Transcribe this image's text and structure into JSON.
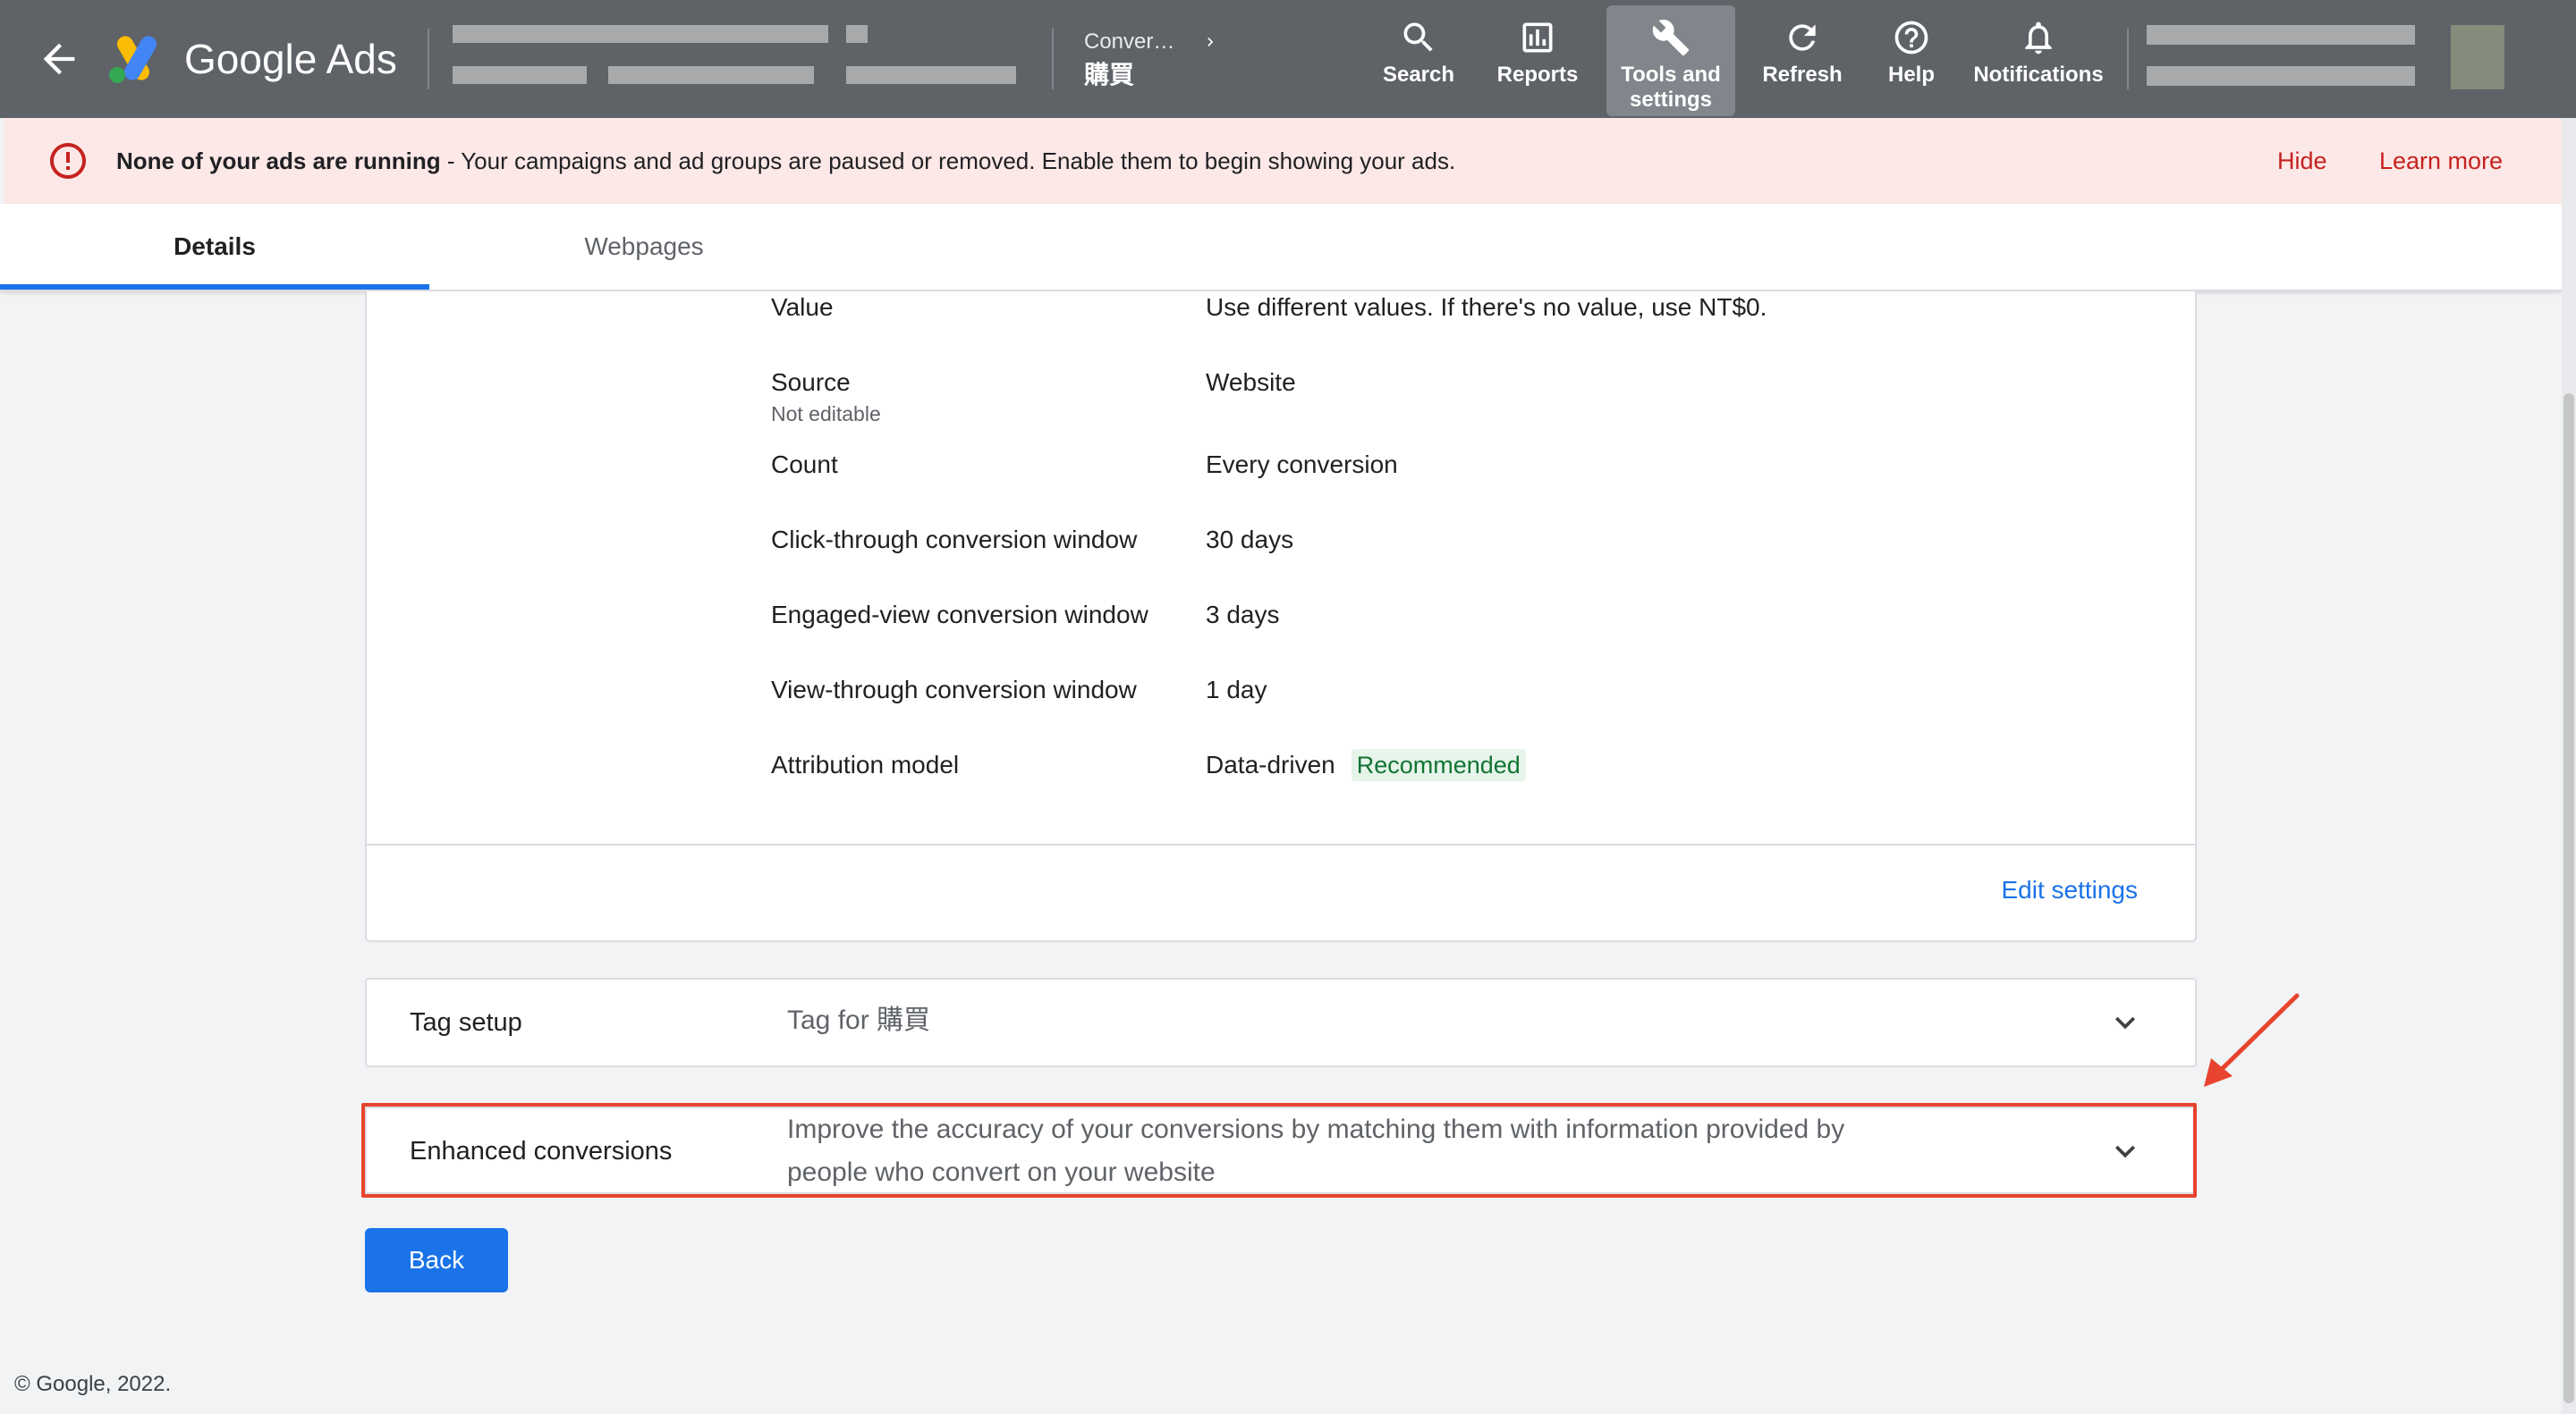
{
  "header": {
    "product_name": "Google Ads",
    "breadcrumb": {
      "parent": "Conver…",
      "current": "購買"
    },
    "nav": [
      {
        "label": "Search",
        "icon": "search-icon"
      },
      {
        "label": "Reports",
        "icon": "reports-icon"
      },
      {
        "label": "Tools and settings",
        "icon": "wrench-icon",
        "active": true
      },
      {
        "label": "Refresh",
        "icon": "refresh-icon"
      },
      {
        "label": "Help",
        "icon": "help-icon"
      },
      {
        "label": "Notifications",
        "icon": "bell-icon"
      }
    ]
  },
  "alert": {
    "bold": "None of your ads are running",
    "text": " - Your campaigns and ad groups are paused or removed. Enable them to begin showing your ads.",
    "hide": "Hide",
    "learn_more": "Learn more",
    "color": "#c5221f"
  },
  "tabs": [
    {
      "label": "Details",
      "active": true
    },
    {
      "label": "Webpages",
      "active": false
    }
  ],
  "settings": {
    "rows": [
      {
        "label": "Value",
        "value": "Use different values. If there's no value, use NT$0."
      },
      {
        "label": "Source",
        "sub": "Not editable",
        "value": "Website"
      },
      {
        "label": "Count",
        "value": "Every conversion"
      },
      {
        "label": "Click-through conversion window",
        "value": "30 days"
      },
      {
        "label": "Engaged-view conversion window",
        "value": "3 days"
      },
      {
        "label": "View-through conversion window",
        "value": "1 day"
      },
      {
        "label": "Attribution model",
        "value": "Data-driven",
        "badge": "Recommended"
      }
    ],
    "edit_label": "Edit settings"
  },
  "tag_setup": {
    "title": "Tag setup",
    "desc": "Tag for 購買"
  },
  "enhanced": {
    "title": "Enhanced conversions",
    "desc_line1": "Improve the accuracy of your conversions by matching them with information provided by",
    "desc_line2": "people who convert on your website"
  },
  "back_label": "Back",
  "copyright": "© Google, 2022.",
  "colors": {
    "accent": "#1a73e8",
    "header": "#5f6368",
    "alert_bg": "#fce8e6",
    "highlight": "#e8432e"
  }
}
